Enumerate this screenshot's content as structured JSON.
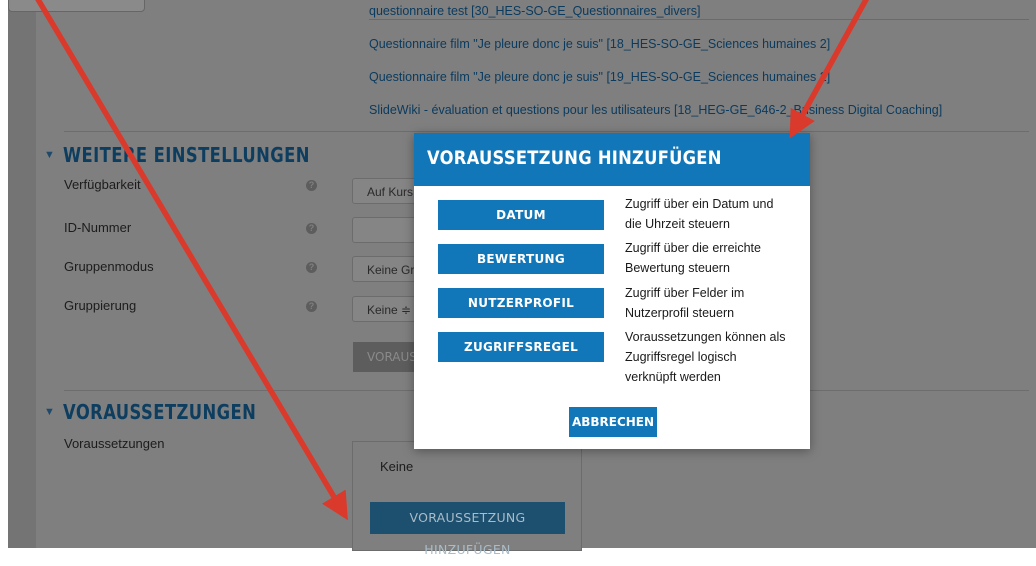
{
  "links": [
    "questionnaire test [30_HES-SO-GE_Questionnaires_divers]",
    "Questionnaire film \"Je pleure donc je suis\" [18_HES-SO-GE_Sciences humaines 2]",
    "Questionnaire film \"Je pleure donc je suis\" [19_HES-SO-GE_Sciences humaines 2]",
    "SlideWiki - évaluation et questions pour les utilisateurs [18_HEG-GE_646-2_Business Digital Coaching]"
  ],
  "section_more": {
    "title": "WEITERE EINSTELLUNGEN",
    "fields": [
      {
        "label": "Verfügbarkeit",
        "value": "Auf Kurs"
      },
      {
        "label": "ID-Nummer",
        "value": ""
      },
      {
        "label": "Gruppenmodus",
        "value": "Keine Gr"
      },
      {
        "label": "Gruppierung",
        "value": "Keine ≑"
      }
    ],
    "dim_button": "VORAUS"
  },
  "section_restrict": {
    "title": "VORAUSSETZUNGEN",
    "label": "Voraussetzungen",
    "none_text": "Keine",
    "add_button": "VORAUSSETZUNG HINZUFÜGEN"
  },
  "modal": {
    "title": "VORAUSSETZUNG HINZUFÜGEN",
    "options": [
      {
        "button": "DATUM",
        "desc_1": "Zugriff über ein Datum und",
        "desc_2": "die Uhrzeit steuern",
        "desc_3": ""
      },
      {
        "button": "BEWERTUNG",
        "desc_1": "Zugriff über die erreichte",
        "desc_2": "Bewertung steuern",
        "desc_3": ""
      },
      {
        "button": "NUTZERPROFIL",
        "desc_1": "Zugriff über Felder im",
        "desc_2": "Nutzerprofil steuern",
        "desc_3": ""
      },
      {
        "button": "ZUGRIFFSREGEL",
        "desc_1": "Voraussetzungen können als",
        "desc_2": "Zugriffsregel logisch",
        "desc_3": "verknüpft werden"
      }
    ],
    "cancel": "ABBRECHEN"
  },
  "colors": {
    "accent": "#1177b8",
    "overlay_bg": "#7f7f7f",
    "arrow": "#d93a2b"
  },
  "icons": {
    "chevron": "chevron-down-icon",
    "help": "help-icon",
    "arrow": "red-pointer-arrow"
  }
}
